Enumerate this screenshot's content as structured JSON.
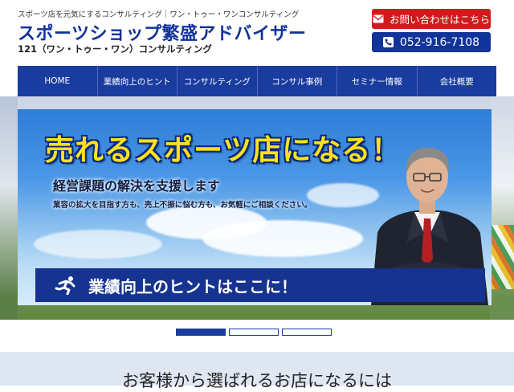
{
  "header": {
    "tagline": "スポーツ店を元気にするコンサルティング｜ワン・トゥー・ワンコンサルティング",
    "site_title": "スポーツショップ繁盛アドバイザー",
    "subtitle": "121（ワン・トゥー・ワン）コンサルティング",
    "contact_label": "お問い合わせはこちら",
    "phone": "052-916-7108"
  },
  "nav": {
    "items": [
      {
        "label": "HOME"
      },
      {
        "label": "業績向上のヒント"
      },
      {
        "label": "コンサルティング"
      },
      {
        "label": "コンサル事例"
      },
      {
        "label": "セミナー情報"
      },
      {
        "label": "会社概要"
      }
    ]
  },
  "hero": {
    "headline": "売れるスポーツ店になる！",
    "subheading": "経営課題の解決を支援します",
    "description": "業容の拡大を目指す方も、売上不振に悩む方も、お気軽にご相談ください。",
    "hint_banner": "業績向上のヒントはここに！"
  },
  "slider": {
    "active_index": 0,
    "count": 3
  },
  "section": {
    "title": "お客様から選ばれるお店になるには"
  },
  "colors": {
    "brand_blue": "#1a3c9e",
    "contact_red": "#cf1b1b",
    "headline_yellow": "#ffe21a"
  },
  "icons": {
    "contact": "envelope-icon",
    "phone": "phone-icon",
    "runner": "runner-icon"
  }
}
